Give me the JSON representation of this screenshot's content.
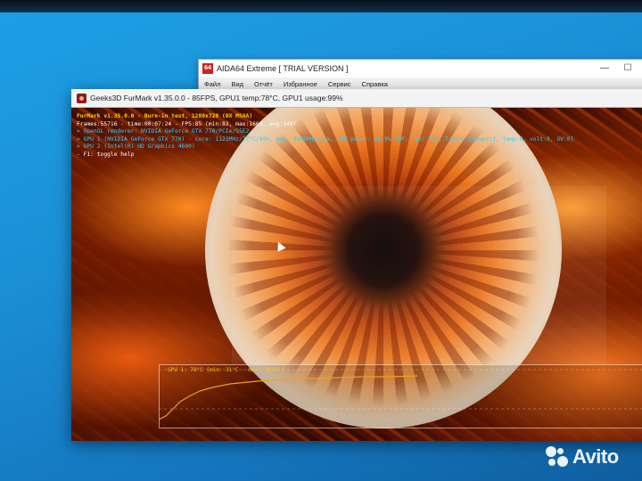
{
  "aida": {
    "title": "AIDA64 Extreme  [ TRIAL VERSION ]",
    "logo": "64",
    "menu": [
      "Файл",
      "Вид",
      "Отчёт",
      "Избранное",
      "Сервис",
      "Справка"
    ],
    "minimize": "—",
    "maximize": "☐",
    "close": "✕"
  },
  "furmark": {
    "title": "Geeks3D FurMark v1.35.0.0 - 85FPS, GPU1 temp:78°C, GPU1 usage:99%",
    "hud": {
      "line1": "FurMark v1.35.0.0 - Burn-in test, 1280x720 (0X MSAA)",
      "line2": "Frames:55716 - time:00:07:24 - FPS:85 (min:83, max:1669, avg:148)",
      "line3": "> OpenGL renderer: NVIDIA GeForce GTX 770/PCIe/SSE2",
      "line4": "> GPU 1 (NVIDIA GeForce GTX 770) - core: 1123MHz/77°C/99%, mem: 3505MHz/11%, GPU power: 88.9% TDP, fan: 78%, limits:[power:1, temp:0, volt:0, OV:0]",
      "line5": "> GPU 2 (Intel(R) HD Graphics 4600)",
      "line6": "- F1: toggle help"
    },
    "graph_label": "GPU 1: 78°C (min: 31°C - max: 78°C)",
    "gpu_temp_series": {
      "min": 31,
      "max": 78
    }
  },
  "watermark": {
    "brand": "Avito"
  },
  "colors": {
    "hud_yellow": "#ffd400",
    "hud_cyan": "#2ad3ff",
    "graph_line": "#f0a020"
  }
}
